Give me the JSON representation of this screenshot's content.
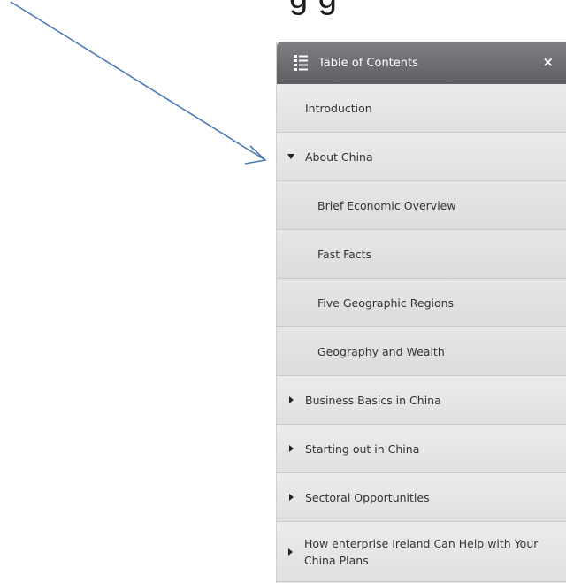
{
  "caption": "g  g",
  "toc": {
    "title": "Table of Contents",
    "close_label": "×",
    "items": [
      {
        "label": "Introduction",
        "level": 1,
        "toggle": "none"
      },
      {
        "label": "About China",
        "level": 1,
        "toggle": "expanded"
      },
      {
        "label": "Brief Economic Overview",
        "level": 2,
        "toggle": "none"
      },
      {
        "label": "Fast Facts",
        "level": 2,
        "toggle": "none"
      },
      {
        "label": "Five Geographic Regions",
        "level": 2,
        "toggle": "none"
      },
      {
        "label": "Geography and Wealth",
        "level": 2,
        "toggle": "none"
      },
      {
        "label": "Business Basics in China",
        "level": 1,
        "toggle": "collapsed"
      },
      {
        "label": "Starting out in China",
        "level": 1,
        "toggle": "collapsed"
      },
      {
        "label": "Sectoral Opportunities",
        "level": 1,
        "toggle": "collapsed"
      },
      {
        "label": "How enterprise Ireland Can Help with Your China Plans",
        "level": 1,
        "toggle": "collapsed"
      }
    ]
  },
  "colors": {
    "arrow": "#4a7ab8",
    "header": "#6a6c6f"
  }
}
